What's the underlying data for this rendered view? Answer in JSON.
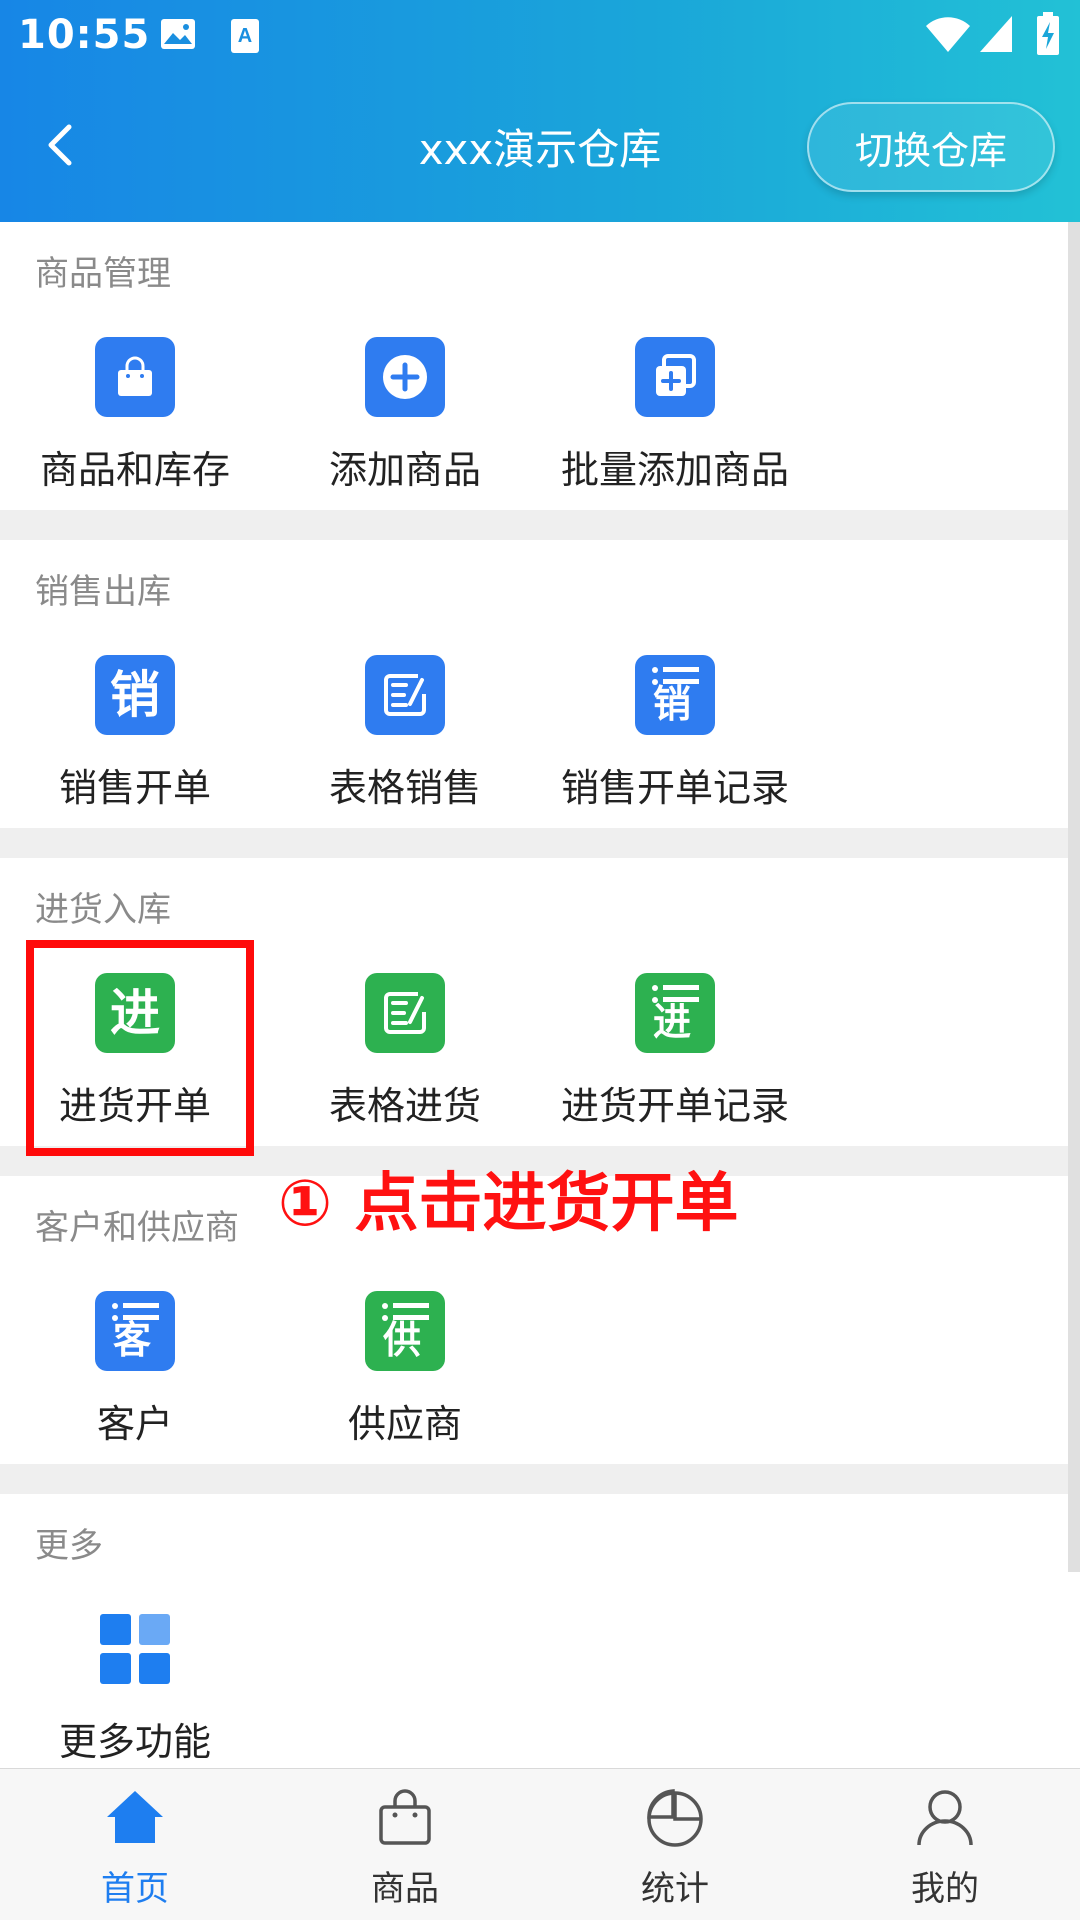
{
  "status_bar": {
    "time": "10:55"
  },
  "header": {
    "title": "xxx演示仓库",
    "switch_label": "切换仓库"
  },
  "sections": [
    {
      "title": "商品管理",
      "items": [
        {
          "label": "商品和库存",
          "icon": "shopping-bag-icon"
        },
        {
          "label": "添加商品",
          "icon": "plus-circle-icon"
        },
        {
          "label": "批量添加商品",
          "icon": "batch-add-icon"
        }
      ]
    },
    {
      "title": "销售出库",
      "items": [
        {
          "label": "销售开单",
          "icon": "sales-order-icon",
          "glyph": "销"
        },
        {
          "label": "表格销售",
          "icon": "table-edit-icon"
        },
        {
          "label": "销售开单记录",
          "icon": "sales-record-icon",
          "glyph": "销"
        }
      ]
    },
    {
      "title": "进货入库",
      "items": [
        {
          "label": "进货开单",
          "icon": "purchase-order-icon",
          "glyph": "进"
        },
        {
          "label": "表格进货",
          "icon": "table-edit-icon"
        },
        {
          "label": "进货开单记录",
          "icon": "purchase-record-icon",
          "glyph": "进"
        }
      ]
    },
    {
      "title": "客户和供应商",
      "items": [
        {
          "label": "客户",
          "icon": "customer-icon",
          "glyph": "客"
        },
        {
          "label": "供应商",
          "icon": "supplier-icon",
          "glyph": "供"
        }
      ]
    },
    {
      "title": "更多",
      "items": [
        {
          "label": "更多功能",
          "icon": "grid-icon"
        }
      ]
    }
  ],
  "annotation": {
    "text": "① 点击进货开单",
    "color": "#ff1111"
  },
  "tabbar": {
    "items": [
      {
        "label": "首页",
        "icon": "home-icon",
        "active": true
      },
      {
        "label": "商品",
        "icon": "bag-icon",
        "active": false
      },
      {
        "label": "统计",
        "icon": "pie-chart-icon",
        "active": false
      },
      {
        "label": "我的",
        "icon": "user-icon",
        "active": false
      }
    ]
  },
  "colors": {
    "accent": "#1e7ef0",
    "blue_icon": "#2f7cf0",
    "green_icon": "#2db150",
    "header_start": "#1786e6",
    "header_end": "#22c1d6"
  }
}
